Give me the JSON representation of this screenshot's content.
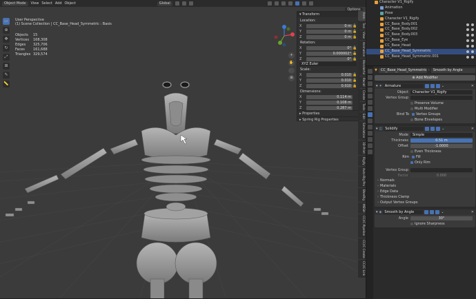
{
  "topbar": {
    "mode": "Object Mode",
    "menus": [
      "View",
      "Select",
      "Add",
      "Object"
    ],
    "orientation": "Global"
  },
  "viewport": {
    "info_line1": "User Perspective",
    "info_line2": "(1) Scene Collection | CC_Base_Head_Symmetric : Basis",
    "stats": [
      {
        "k": "Objects",
        "v": "15"
      },
      {
        "k": "Vertices",
        "v": "168,308"
      },
      {
        "k": "Edges",
        "v": "325,706"
      },
      {
        "k": "Faces",
        "v": "161,688"
      },
      {
        "k": "Triangles",
        "v": "329,574"
      }
    ],
    "options_label": "Options",
    "gizmo": {
      "x_color": "#e0414e",
      "y_color": "#6aa329",
      "z_color": "#3b7bd6"
    },
    "nav_buttons": [
      "+",
      "✋",
      "🎥",
      "⊞"
    ]
  },
  "npanel": {
    "transform_label": "Transform",
    "location_label": "Location:",
    "location": [
      {
        "k": "X",
        "v": "0 m"
      },
      {
        "k": "Y",
        "v": "0 m"
      },
      {
        "k": "Z",
        "v": "0 m"
      }
    ],
    "rotation_label": "Rotation:",
    "rotation": [
      {
        "k": "X",
        "v": "0°"
      },
      {
        "k": "Y",
        "v": "0.000002°"
      },
      {
        "k": "Z",
        "v": "0°"
      }
    ],
    "euler": "XYZ Euler",
    "scale_label": "Scale:",
    "scale": [
      {
        "k": "X",
        "v": "0.010"
      },
      {
        "k": "Y",
        "v": "0.010"
      },
      {
        "k": "Z",
        "v": "0.010"
      }
    ],
    "dimensions_label": "Dimensions:",
    "dimensions": [
      {
        "k": "X",
        "v": "0.114 m"
      },
      {
        "k": "Y",
        "v": "0.108 m"
      },
      {
        "k": "Z",
        "v": "0.287 m"
      }
    ],
    "properties_label": "Properties",
    "spring_label": "Spring Rig Properties",
    "tabs": [
      "Item",
      "Tool",
      "View",
      "Animation",
      "Wonderful",
      "Recall",
      "Create",
      "Tools",
      "Edit",
      "Simulation",
      "3D-Print",
      "Rigify",
      "Auto-Rig Pro",
      "BlenRig",
      "MESH",
      "CC/IC Pipeline",
      "CC/IC Create",
      "CC/IC Link"
    ]
  },
  "outliner": {
    "rows": [
      {
        "name": "Character V1_Rigify",
        "indent": 12,
        "color": "#e8a13a",
        "sel": false,
        "vis": false
      },
      {
        "name": "Animation",
        "indent": 20,
        "color": "#7b9bd6",
        "sel": false,
        "vis": false
      },
      {
        "name": "Pose",
        "indent": 20,
        "color": "#5aa3a3",
        "sel": false,
        "vis": false
      },
      {
        "name": "Character V1_Rigify",
        "indent": 20,
        "color": "#e8a13a",
        "sel": false,
        "vis": false
      },
      {
        "name": "CC_Base_Body.001",
        "indent": 20,
        "color": "#e8a13a",
        "sel": false,
        "vis": true
      },
      {
        "name": "CC_Base_Body.002",
        "indent": 20,
        "color": "#e8a13a",
        "sel": false,
        "vis": true
      },
      {
        "name": "CC_Base_Body.003",
        "indent": 20,
        "color": "#e8a13a",
        "sel": false,
        "vis": true
      },
      {
        "name": "CC_Base_Eye",
        "indent": 20,
        "color": "#e8a13a",
        "sel": false,
        "vis": true
      },
      {
        "name": "CC_Base_Head",
        "indent": 20,
        "color": "#e8a13a",
        "sel": false,
        "vis": true
      },
      {
        "name": "CC_Base_Head_Symmetric",
        "indent": 20,
        "color": "#e8a13a",
        "sel": true,
        "vis": true
      },
      {
        "name": "CC_Base_Head_Symmetric.001",
        "indent": 20,
        "color": "#e8a13a",
        "sel": false,
        "vis": true
      }
    ]
  },
  "properties": {
    "object_name": "CC_Base_Head_Symmetric",
    "modifier_dropdown": "Smooth by Angle",
    "add_modifier": "Add Modifier",
    "armature": {
      "name": "Armature",
      "object_label": "Object",
      "object_value": "Character V1_Rigify",
      "vgroup_label": "Vertex Group",
      "preserve_volume": "Preserve Volume",
      "multi_modifier": "Multi Modifier",
      "bind_to_label": "Bind To",
      "vertex_groups": "Vertex Groups",
      "bone_envelopes": "Bone Envelopes"
    },
    "solidify": {
      "name": "Solidify",
      "mode_label": "Mode",
      "mode_value": "Simple",
      "thickness_label": "Thickness",
      "thickness_value": "0.51 m",
      "offset_label": "Offset",
      "offset_value": "-1.0000",
      "even_thickness": "Even Thickness",
      "rim_label": "Rim",
      "fill": "Fill",
      "only_rim": "Only Rim",
      "vgroup_label": "Vertex Group",
      "factor_label": "Factor",
      "factor_value": "0.000"
    },
    "sections": [
      "Normals",
      "Materials",
      "Edge Data",
      "Thickness Clamp",
      "Output Vertex Groups"
    ],
    "smooth": {
      "name": "Smooth by Angle",
      "angle_label": "Angle",
      "angle_value": "30°",
      "ignore_sharpness": "Ignore Sharpness"
    }
  }
}
